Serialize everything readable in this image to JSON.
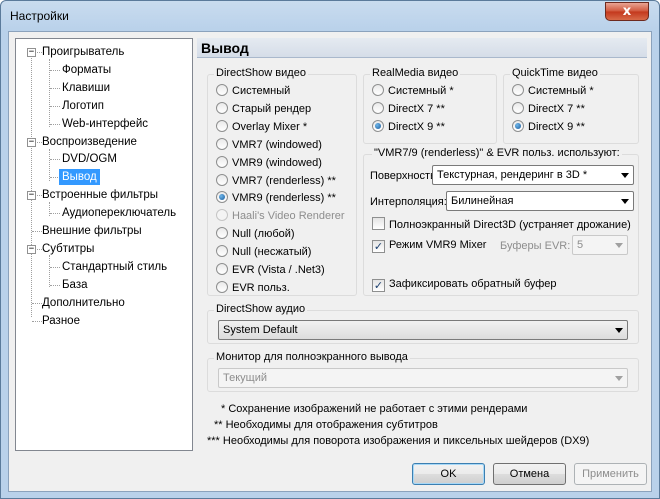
{
  "window": {
    "title": "Настройки",
    "close_label": "x"
  },
  "tree": {
    "items": [
      {
        "label": "Проигрыватель",
        "level": 0
      },
      {
        "label": "Форматы",
        "level": 1
      },
      {
        "label": "Клавиши",
        "level": 1
      },
      {
        "label": "Логотип",
        "level": 1
      },
      {
        "label": "Web-интерфейс",
        "level": 1
      },
      {
        "label": "Воспроизведение",
        "level": 0
      },
      {
        "label": "DVD/OGM",
        "level": 1
      },
      {
        "label": "Вывод",
        "level": 1,
        "selected": true
      },
      {
        "label": "Встроенные фильтры",
        "level": 0
      },
      {
        "label": "Аудиопереключатель",
        "level": 1
      },
      {
        "label": "Внешние фильтры",
        "level": 0
      },
      {
        "label": "Субтитры",
        "level": 0
      },
      {
        "label": "Стандартный стиль",
        "level": 1
      },
      {
        "label": "База",
        "level": 1
      },
      {
        "label": "Дополнительно",
        "level": 0
      },
      {
        "label": "Разное",
        "level": 0
      }
    ],
    "expander_symbol": "−"
  },
  "panel": {
    "header": "Вывод",
    "directshow_video": {
      "title": "DirectShow видео",
      "options": [
        {
          "label": "Системный",
          "selected": false,
          "disabled": false
        },
        {
          "label": "Старый рендер",
          "selected": false,
          "disabled": false
        },
        {
          "label": "Overlay Mixer *",
          "selected": false,
          "disabled": false
        },
        {
          "label": "VMR7 (windowed)",
          "selected": false,
          "disabled": false
        },
        {
          "label": "VMR9 (windowed)",
          "selected": false,
          "disabled": false
        },
        {
          "label": "VMR7 (renderless) **",
          "selected": false,
          "disabled": false
        },
        {
          "label": "VMR9 (renderless) **",
          "selected": true,
          "disabled": false
        },
        {
          "label": "Haali's Video Renderer",
          "selected": false,
          "disabled": true
        },
        {
          "label": "Null (любой)",
          "selected": false,
          "disabled": false
        },
        {
          "label": "Null (несжатый)",
          "selected": false,
          "disabled": false
        },
        {
          "label": "EVR (Vista / .Net3)",
          "selected": false,
          "disabled": false
        },
        {
          "label": "EVR польз.",
          "selected": false,
          "disabled": false
        }
      ]
    },
    "realmedia_video": {
      "title": "RealMedia видео",
      "options": [
        {
          "label": "Системный *",
          "selected": false
        },
        {
          "label": "DirectX 7 **",
          "selected": false
        },
        {
          "label": "DirectX 9 **",
          "selected": true
        }
      ]
    },
    "quicktime_video": {
      "title": "QuickTime видео",
      "options": [
        {
          "label": "Системный *",
          "selected": false
        },
        {
          "label": "DirectX 7 **",
          "selected": false
        },
        {
          "label": "DirectX 9 **",
          "selected": true
        }
      ]
    },
    "vmr_settings": {
      "title": "\"VMR7/9 (renderless)\" & EVR польз. используют:",
      "surface_label": "Поверхность:",
      "surface_value": "Текстурная, рендеринг в 3D *",
      "interpolation_label": "Интерполяция:",
      "interpolation_value": "Билинейная",
      "fullscreen_d3d_label": "Полноэкранный Direct3D (устраняет дрожание)",
      "fullscreen_d3d_checked": false,
      "vmr9_mixer_label": "Режим VMR9 Mixer",
      "vmr9_mixer_checked": true,
      "evr_buffers_label": "Буферы EVR:",
      "evr_buffers_value": "5",
      "lock_backbuffer_label": "Зафиксировать обратный буфер",
      "lock_backbuffer_checked": true,
      "check_mark": "✓"
    },
    "directshow_audio": {
      "title": "DirectShow аудио",
      "value": "System Default"
    },
    "fullscreen_monitor": {
      "title": "Монитор для полноэкранного вывода",
      "value": "Текущий"
    },
    "notes": [
      "* Сохранение изображений не работает с этими рендерами",
      "** Необходимы для отображения субтитров",
      "*** Необходимы для поворота изображения и пиксельных шейдеров (DX9)"
    ]
  },
  "buttons": {
    "ok": "OK",
    "cancel": "Отмена",
    "apply": "Применить"
  }
}
